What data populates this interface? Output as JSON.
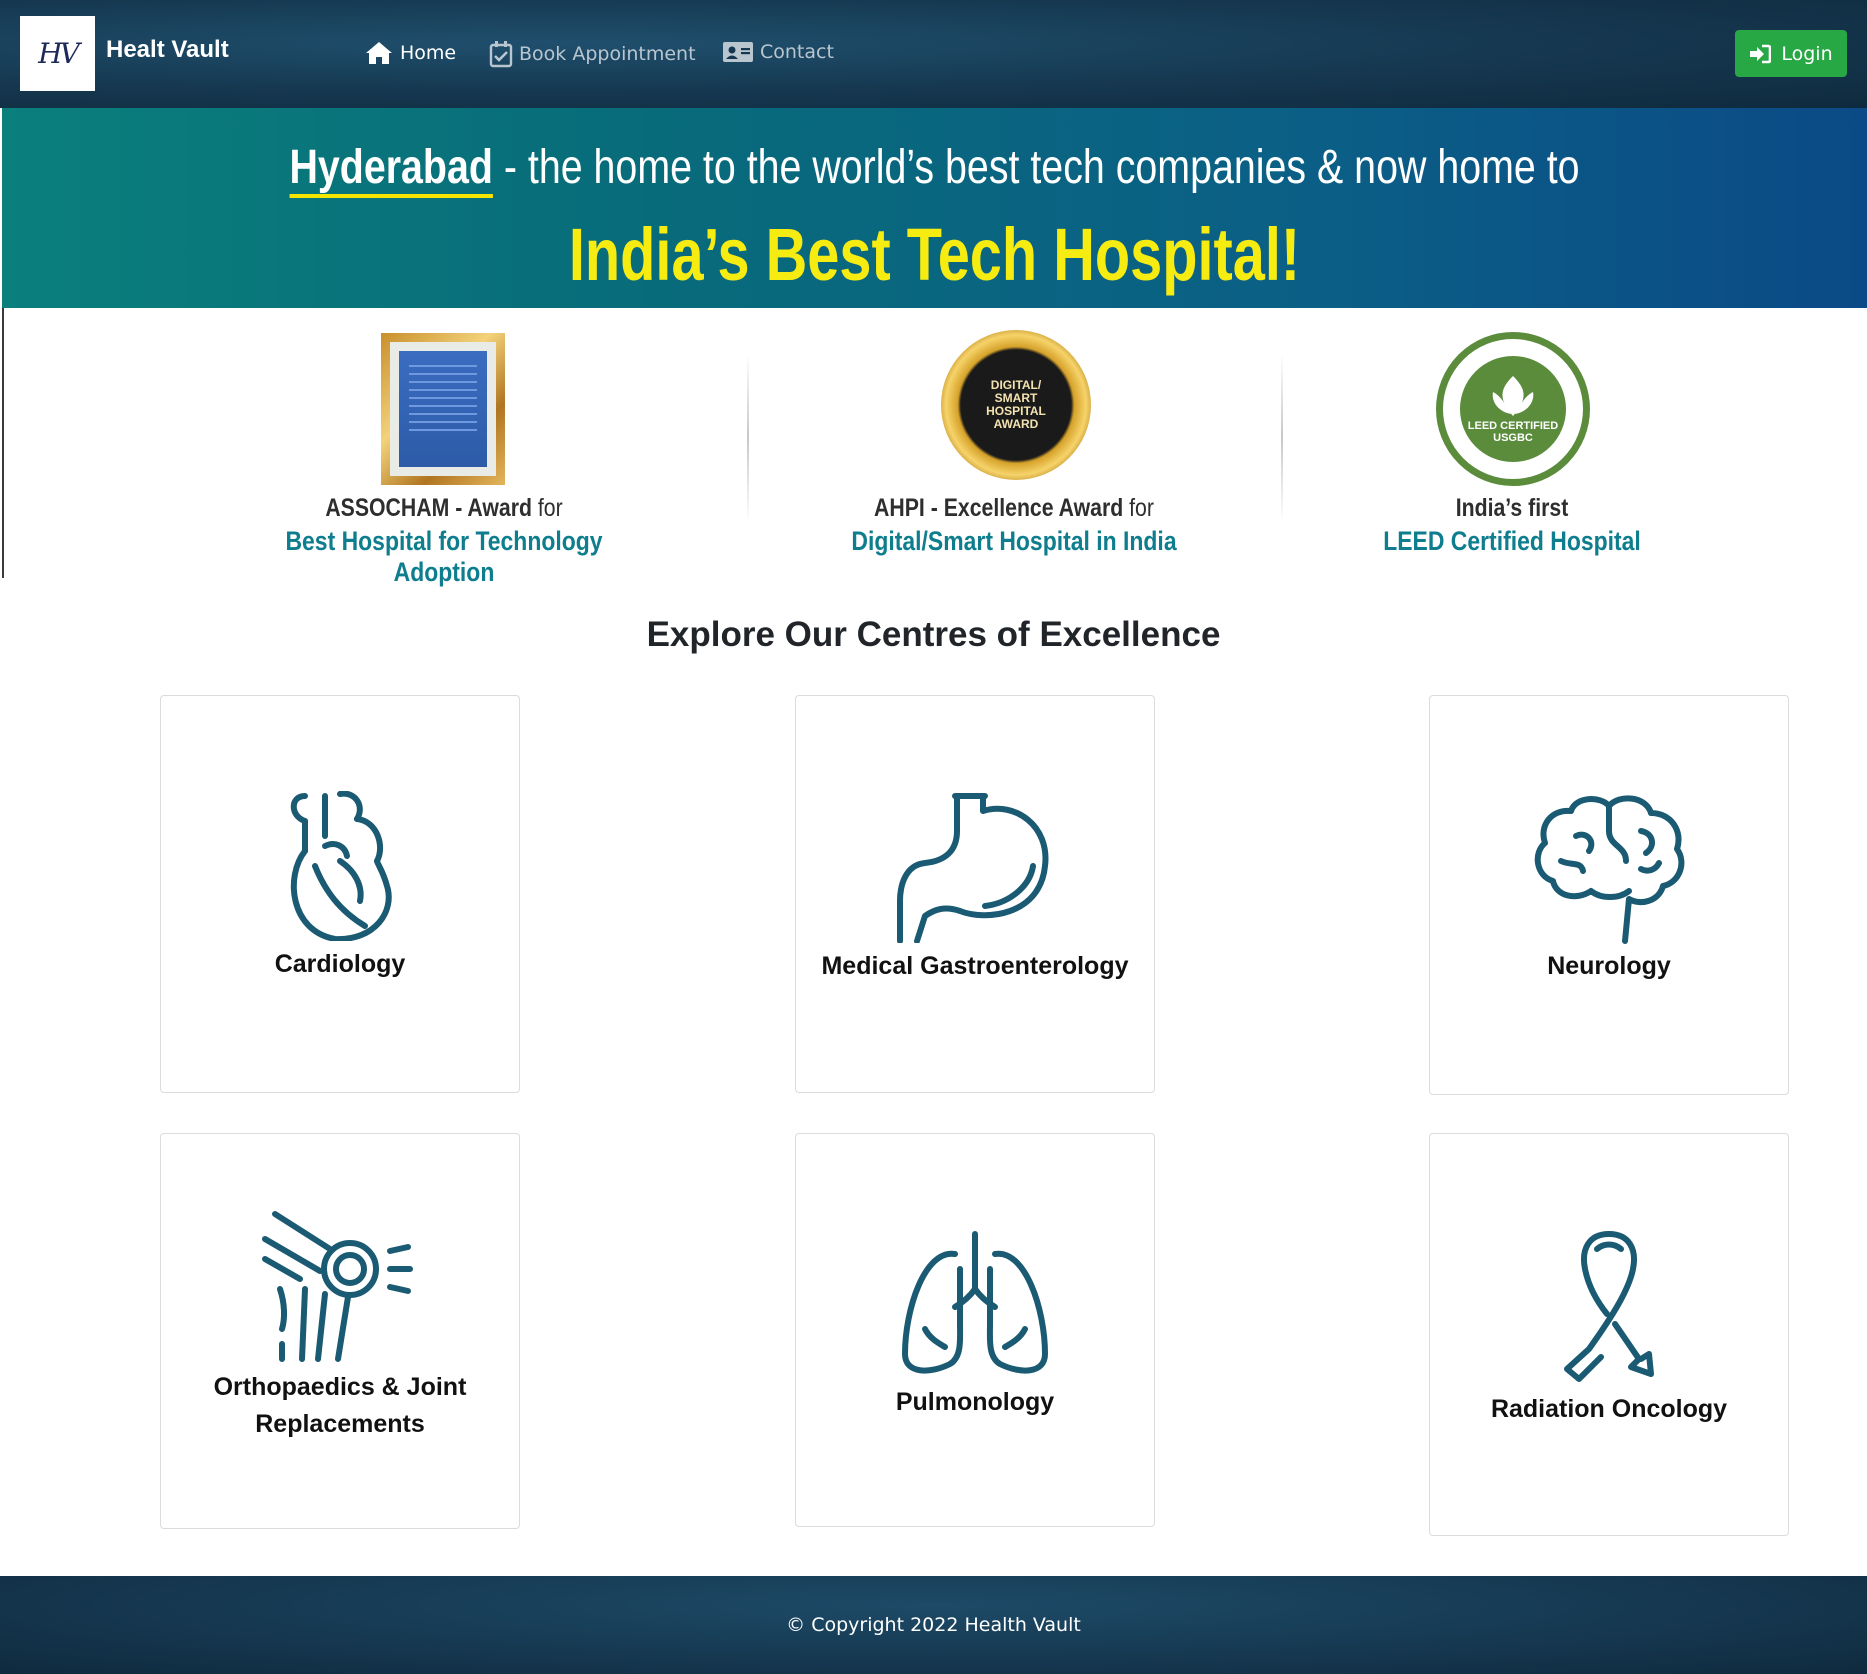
{
  "navbar": {
    "logo_text": "HV",
    "brand": "Healt Vault",
    "links": [
      {
        "label": "Home",
        "icon": "home-icon",
        "active": true
      },
      {
        "label": "Book Appointment",
        "icon": "calendar-check-icon",
        "active": false
      },
      {
        "label": "Contact",
        "icon": "id-card-icon",
        "active": false
      }
    ],
    "login_label": "Login"
  },
  "banner": {
    "city": "Hyderabad",
    "line1_rest": " - the home to the world’s best tech companies & now home to",
    "line2": "India’s Best Tech Hospital!"
  },
  "awards": [
    {
      "line1_bold": "ASSOCHAM - Award",
      "line1_light": " for",
      "line2": "Best Hospital for Technology Adoption"
    },
    {
      "line1_bold": "AHPI - Excellence Award",
      "line1_light": " for",
      "line2": "Digital/Smart Hospital in India",
      "badge": [
        "DIGITAL/",
        "SMART",
        "HOSPITAL",
        "AWARD"
      ]
    },
    {
      "line1_bold": "India’s first",
      "line1_light": "",
      "line2": "LEED Certified Hospital",
      "badge": [
        "LEED CERTIFIED",
        "USGBC"
      ]
    }
  ],
  "centres": {
    "title": "Explore Our Centres of Excellence",
    "items": [
      {
        "label": "Cardiology",
        "icon": "heart-organ-icon"
      },
      {
        "label": "Medical Gastroenterology",
        "icon": "stomach-icon"
      },
      {
        "label": "Neurology",
        "icon": "brain-icon"
      },
      {
        "label": "Orthopaedics & Joint Replacements",
        "icon": "knee-joint-icon"
      },
      {
        "label": "Pulmonology",
        "icon": "lungs-icon"
      },
      {
        "label": "Radiation Oncology",
        "icon": "awareness-ribbon-icon"
      }
    ]
  },
  "footer": {
    "copyright": "© Copyright 2022 Health Vault"
  },
  "colors": {
    "navbar_bg": "#15374f",
    "login_green": "#28a745",
    "banner_yellow": "#f7ec12",
    "award_teal": "#0e7e8e",
    "icon_stroke": "#1a5a73"
  }
}
